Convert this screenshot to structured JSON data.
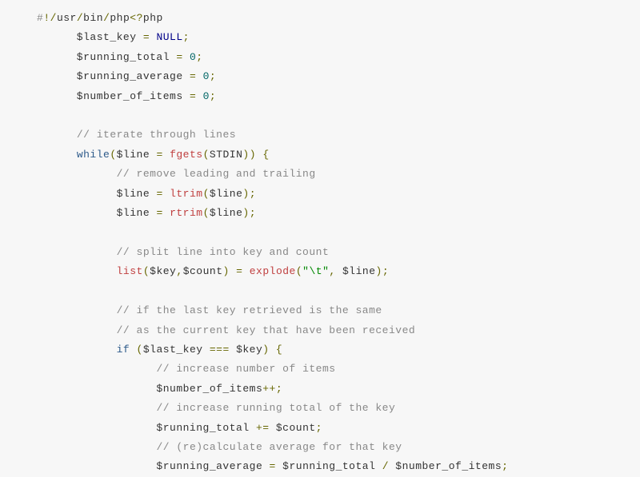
{
  "code": {
    "line01": [
      {
        "t": "#",
        "c": "c-comment"
      },
      {
        "t": "!",
        "c": "c-op"
      },
      {
        "t": "/",
        "c": "c-op"
      },
      {
        "t": "usr",
        "c": "c-plain"
      },
      {
        "t": "/",
        "c": "c-op"
      },
      {
        "t": "bin",
        "c": "c-plain"
      },
      {
        "t": "/",
        "c": "c-op"
      },
      {
        "t": "php",
        "c": "c-plain"
      },
      {
        "t": "<?",
        "c": "c-op"
      },
      {
        "t": "php",
        "c": "c-plain"
      }
    ],
    "line02": [
      {
        "t": "      $last_key ",
        "c": "c-var"
      },
      {
        "t": "=",
        "c": "c-op"
      },
      {
        "t": " ",
        "c": "c-plain"
      },
      {
        "t": "NULL",
        "c": "c-null"
      },
      {
        "t": ";",
        "c": "c-op"
      }
    ],
    "line03": [
      {
        "t": "      $running_total ",
        "c": "c-var"
      },
      {
        "t": "=",
        "c": "c-op"
      },
      {
        "t": " ",
        "c": "c-plain"
      },
      {
        "t": "0",
        "c": "c-num"
      },
      {
        "t": ";",
        "c": "c-op"
      }
    ],
    "line04": [
      {
        "t": "      $running_average ",
        "c": "c-var"
      },
      {
        "t": "=",
        "c": "c-op"
      },
      {
        "t": " ",
        "c": "c-plain"
      },
      {
        "t": "0",
        "c": "c-num"
      },
      {
        "t": ";",
        "c": "c-op"
      }
    ],
    "line05": [
      {
        "t": "      $number_of_items ",
        "c": "c-var"
      },
      {
        "t": "=",
        "c": "c-op"
      },
      {
        "t": " ",
        "c": "c-plain"
      },
      {
        "t": "0",
        "c": "c-num"
      },
      {
        "t": ";",
        "c": "c-op"
      }
    ],
    "line06": [
      {
        "t": "",
        "c": "c-plain"
      }
    ],
    "line07": [
      {
        "t": "      ",
        "c": "c-plain"
      },
      {
        "t": "// iterate through lines",
        "c": "c-comment"
      }
    ],
    "line08": [
      {
        "t": "      ",
        "c": "c-plain"
      },
      {
        "t": "while",
        "c": "c-kw"
      },
      {
        "t": "(",
        "c": "c-op"
      },
      {
        "t": "$line ",
        "c": "c-var"
      },
      {
        "t": "=",
        "c": "c-op"
      },
      {
        "t": " ",
        "c": "c-plain"
      },
      {
        "t": "fgets",
        "c": "c-func"
      },
      {
        "t": "(",
        "c": "c-op"
      },
      {
        "t": "STDIN",
        "c": "c-plain"
      },
      {
        "t": "))",
        "c": "c-op"
      },
      {
        "t": " ",
        "c": "c-plain"
      },
      {
        "t": "{",
        "c": "c-op"
      }
    ],
    "line09": [
      {
        "t": "            ",
        "c": "c-plain"
      },
      {
        "t": "// remove leading and trailing",
        "c": "c-comment"
      }
    ],
    "line10": [
      {
        "t": "            $line ",
        "c": "c-var"
      },
      {
        "t": "=",
        "c": "c-op"
      },
      {
        "t": " ",
        "c": "c-plain"
      },
      {
        "t": "ltrim",
        "c": "c-func"
      },
      {
        "t": "(",
        "c": "c-op"
      },
      {
        "t": "$line",
        "c": "c-var"
      },
      {
        "t": ");",
        "c": "c-op"
      }
    ],
    "line11": [
      {
        "t": "            $line ",
        "c": "c-var"
      },
      {
        "t": "=",
        "c": "c-op"
      },
      {
        "t": " ",
        "c": "c-plain"
      },
      {
        "t": "rtrim",
        "c": "c-func"
      },
      {
        "t": "(",
        "c": "c-op"
      },
      {
        "t": "$line",
        "c": "c-var"
      },
      {
        "t": ");",
        "c": "c-op"
      }
    ],
    "line12": [
      {
        "t": "",
        "c": "c-plain"
      }
    ],
    "line13": [
      {
        "t": "            ",
        "c": "c-plain"
      },
      {
        "t": "// split line into key and count",
        "c": "c-comment"
      }
    ],
    "line14": [
      {
        "t": "            ",
        "c": "c-plain"
      },
      {
        "t": "list",
        "c": "c-func"
      },
      {
        "t": "(",
        "c": "c-op"
      },
      {
        "t": "$key",
        "c": "c-var"
      },
      {
        "t": ",",
        "c": "c-op"
      },
      {
        "t": "$count",
        "c": "c-var"
      },
      {
        "t": ")",
        "c": "c-op"
      },
      {
        "t": " ",
        "c": "c-plain"
      },
      {
        "t": "=",
        "c": "c-op"
      },
      {
        "t": " ",
        "c": "c-plain"
      },
      {
        "t": "explode",
        "c": "c-func"
      },
      {
        "t": "(",
        "c": "c-op"
      },
      {
        "t": "\"\\t\"",
        "c": "c-str"
      },
      {
        "t": ",",
        "c": "c-op"
      },
      {
        "t": " $line",
        "c": "c-var"
      },
      {
        "t": ");",
        "c": "c-op"
      }
    ],
    "line15": [
      {
        "t": "",
        "c": "c-plain"
      }
    ],
    "line16": [
      {
        "t": "            ",
        "c": "c-plain"
      },
      {
        "t": "// if the last key retrieved is the same",
        "c": "c-comment"
      }
    ],
    "line17": [
      {
        "t": "            ",
        "c": "c-plain"
      },
      {
        "t": "// as the current key that have been received",
        "c": "c-comment"
      }
    ],
    "line18": [
      {
        "t": "            ",
        "c": "c-plain"
      },
      {
        "t": "if",
        "c": "c-kw"
      },
      {
        "t": " ",
        "c": "c-plain"
      },
      {
        "t": "(",
        "c": "c-op"
      },
      {
        "t": "$last_key ",
        "c": "c-var"
      },
      {
        "t": "===",
        "c": "c-op"
      },
      {
        "t": " $key",
        "c": "c-var"
      },
      {
        "t": ")",
        "c": "c-op"
      },
      {
        "t": " ",
        "c": "c-plain"
      },
      {
        "t": "{",
        "c": "c-op"
      }
    ],
    "line19": [
      {
        "t": "                  ",
        "c": "c-plain"
      },
      {
        "t": "// increase number of items",
        "c": "c-comment"
      }
    ],
    "line20": [
      {
        "t": "                  $number_of_items",
        "c": "c-var"
      },
      {
        "t": "++;",
        "c": "c-op"
      }
    ],
    "line21": [
      {
        "t": "                  ",
        "c": "c-plain"
      },
      {
        "t": "// increase running total of the key",
        "c": "c-comment"
      }
    ],
    "line22": [
      {
        "t": "                  $running_total ",
        "c": "c-var"
      },
      {
        "t": "+=",
        "c": "c-op"
      },
      {
        "t": " $count",
        "c": "c-var"
      },
      {
        "t": ";",
        "c": "c-op"
      }
    ],
    "line23": [
      {
        "t": "                  ",
        "c": "c-plain"
      },
      {
        "t": "// (re)calculate average for that key",
        "c": "c-comment"
      }
    ],
    "line24": [
      {
        "t": "                  $running_average ",
        "c": "c-var"
      },
      {
        "t": "=",
        "c": "c-op"
      },
      {
        "t": " $running_total ",
        "c": "c-var"
      },
      {
        "t": "/",
        "c": "c-op"
      },
      {
        "t": " $number_of_items",
        "c": "c-var"
      },
      {
        "t": ";",
        "c": "c-op"
      }
    ]
  },
  "line_order": [
    "line01",
    "line02",
    "line03",
    "line04",
    "line05",
    "line06",
    "line07",
    "line08",
    "line09",
    "line10",
    "line11",
    "line12",
    "line13",
    "line14",
    "line15",
    "line16",
    "line17",
    "line18",
    "line19",
    "line20",
    "line21",
    "line22",
    "line23",
    "line24"
  ]
}
